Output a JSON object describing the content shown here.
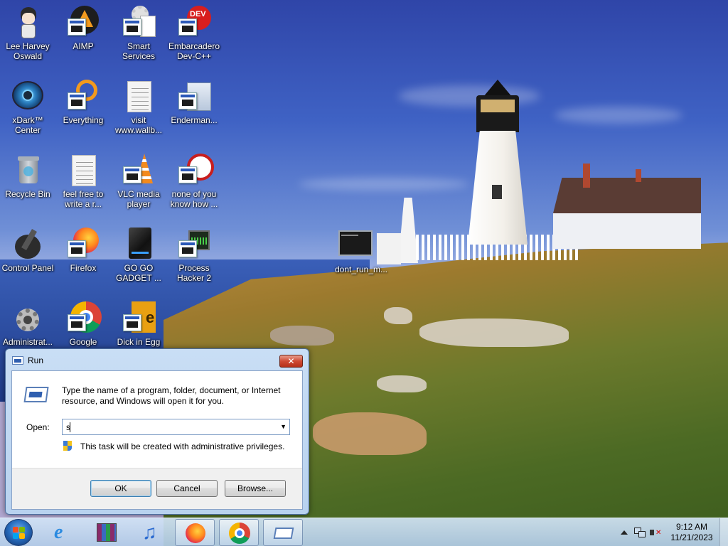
{
  "desktop": {
    "icons": [
      {
        "label": "Lee Harvey\nOswald",
        "icon": "anime-character-icon"
      },
      {
        "label": "AIMP",
        "icon": "aimp-icon"
      },
      {
        "label": "Smart\nServices",
        "icon": "gear-services-icon"
      },
      {
        "label": "Embarcadero\nDev-C++",
        "icon": "devcpp-icon"
      },
      {
        "label": "xDark™\nCenter",
        "icon": "xdark-orb-icon"
      },
      {
        "label": "Everything",
        "icon": "everything-search-icon"
      },
      {
        "label": "visit\nwww.wallb...",
        "icon": "text-document-icon"
      },
      {
        "label": "Enderman...",
        "icon": "application-window-icon"
      },
      {
        "label": "Recycle Bin",
        "icon": "recycle-bin-icon"
      },
      {
        "label": "feel free to\nwrite a r...",
        "icon": "text-document-icon"
      },
      {
        "label": "VLC media\nplayer",
        "icon": "vlc-cone-icon"
      },
      {
        "label": "none of you\nknow how ...",
        "icon": "red-circle-app-icon"
      },
      {
        "label": "Control Panel",
        "icon": "control-panel-icon"
      },
      {
        "label": "Firefox",
        "icon": "firefox-icon"
      },
      {
        "label": "GO GO\nGADGET ...",
        "icon": "gadget-device-icon"
      },
      {
        "label": "Process\nHacker 2",
        "icon": "process-hacker-icon"
      },
      {
        "label": "Administrat...",
        "icon": "admin-tools-icon"
      },
      {
        "label": "Google",
        "icon": "chrome-icon"
      },
      {
        "label": "Dick in Egg",
        "icon": "dick-in-egg-icon"
      },
      {
        "label": "dont_run_m...",
        "icon": "terminal-window-icon"
      }
    ]
  },
  "run_dialog": {
    "title": "Run",
    "close_label": "✕",
    "description": "Type the name of a program, folder, document, or Internet resource, and Windows will open it for you.",
    "open_label": "Open:",
    "open_value": "s",
    "admin_note": "This task will be created with administrative privileges.",
    "ok_label": "OK",
    "cancel_label": "Cancel",
    "browse_label": "Browse..."
  },
  "taskbar": {
    "pinned": [
      "start-orb",
      "internet-explorer-icon",
      "winrar-icon",
      "itunes-icon",
      "firefox-icon",
      "chrome-icon",
      "run-dialog-icon"
    ],
    "tray": {
      "time": "9:12 AM",
      "date": "11/21/2023"
    }
  },
  "colors": {
    "dialog_frame": "#b8d2ef",
    "taskbar": "#c6dbf1",
    "close_button": "#cf4a33"
  }
}
